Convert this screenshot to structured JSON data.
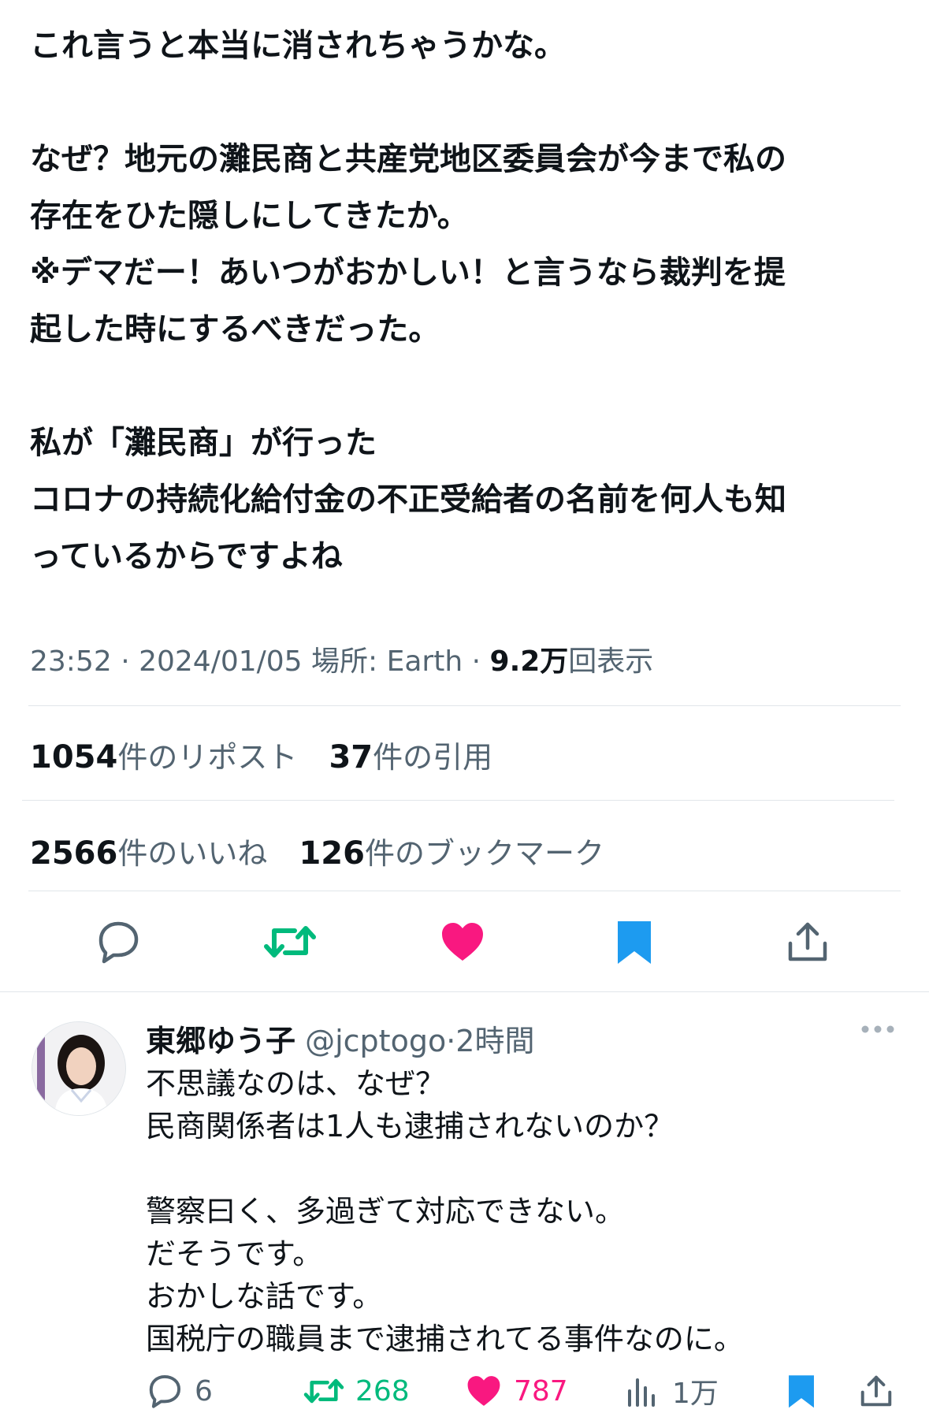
{
  "tweet": {
    "lines": [
      "これ言うと本当に消されちゃうかな。",
      "",
      "なぜ？地元の灘民商と共産党地区委員会が今まで私の",
      "存在をひた隠しにしてきたか。",
      "※デマだー！あいつがおかしい！と言うなら裁判を提",
      "起した時にするべきだった。",
      "",
      "私が「灘民商」が行った",
      "コロナの持続化給付金の不正受給者の名前を何人も知",
      "っているからですよね"
    ],
    "time": "23:52 · 2024/01/05",
    "location": "場所: Earth",
    "separator": "·",
    "views_num": "9.2万",
    "views_label": "回表示"
  },
  "stats": {
    "reposts_num": "1054",
    "reposts_label": "件のリポスト",
    "quotes_num": "37",
    "quotes_label": "件の引用",
    "likes_num": "2566",
    "likes_label": "件のいいね",
    "bookmarks_num": "126",
    "bookmarks_label": "件のブックマーク"
  },
  "colors": {
    "reply_gray": "#536471",
    "retweet_green": "#00ba7c",
    "like_pink": "#f91880",
    "bookmark_blue": "#1d9bf0"
  },
  "icons": [
    "reply-icon",
    "retweet-icon",
    "like-icon",
    "bookmark-icon",
    "share-icon",
    "more-icon",
    "views-icon"
  ],
  "reply": {
    "name": "東郷ゆう子",
    "handle": "@jcptogo",
    "dot": "·",
    "time": "2時間",
    "lines": [
      "不思議なのは、なぜ？",
      "民商関係者は1人も逮捕されないのか？",
      "",
      "警察曰く、多過ぎて対応できない。",
      "だそうです。",
      "おかしな話です。",
      "国税庁の職員まで逮捕されてる事件なのに。"
    ],
    "actions": {
      "replies": "6",
      "retweets": "268",
      "likes": "787",
      "views": "1万"
    }
  }
}
